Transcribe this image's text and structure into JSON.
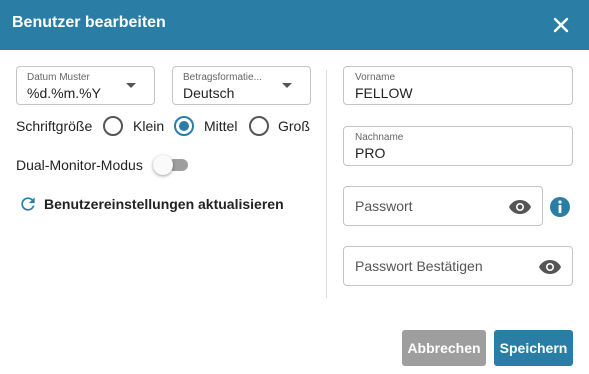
{
  "dialog": {
    "title": "Benutzer bearbeiten",
    "close_icon": "close-icon"
  },
  "left": {
    "date_format": {
      "label": "Datum Muster",
      "value": "%d.%m.%Y"
    },
    "amount_format": {
      "label": "Betragsformatie...",
      "value": "Deutsch"
    },
    "font_size": {
      "label": "Schriftgröße",
      "options": [
        {
          "label": "Klein",
          "checked": false
        },
        {
          "label": "Mittel",
          "checked": true
        },
        {
          "label": "Groß",
          "checked": false
        }
      ]
    },
    "dual_monitor": {
      "label": "Dual-Monitor-Modus",
      "enabled": false
    },
    "refresh_link": {
      "label": "Benutzereinstellungen aktualisieren",
      "icon": "refresh-icon"
    }
  },
  "right": {
    "first_name": {
      "label": "Vorname",
      "value": "FELLOW"
    },
    "last_name": {
      "label": "Nachname",
      "value": "PRO"
    },
    "password": {
      "placeholder": "Passwort",
      "icon": "eye-icon"
    },
    "password_confirm": {
      "placeholder": "Passwort Bestätigen",
      "icon": "eye-icon"
    },
    "info_icon": "info-icon"
  },
  "footer": {
    "cancel_label": "Abbrechen",
    "save_label": "Speichern"
  },
  "colors": {
    "primary": "#2a7ea6",
    "cancel": "#9e9e9e"
  }
}
